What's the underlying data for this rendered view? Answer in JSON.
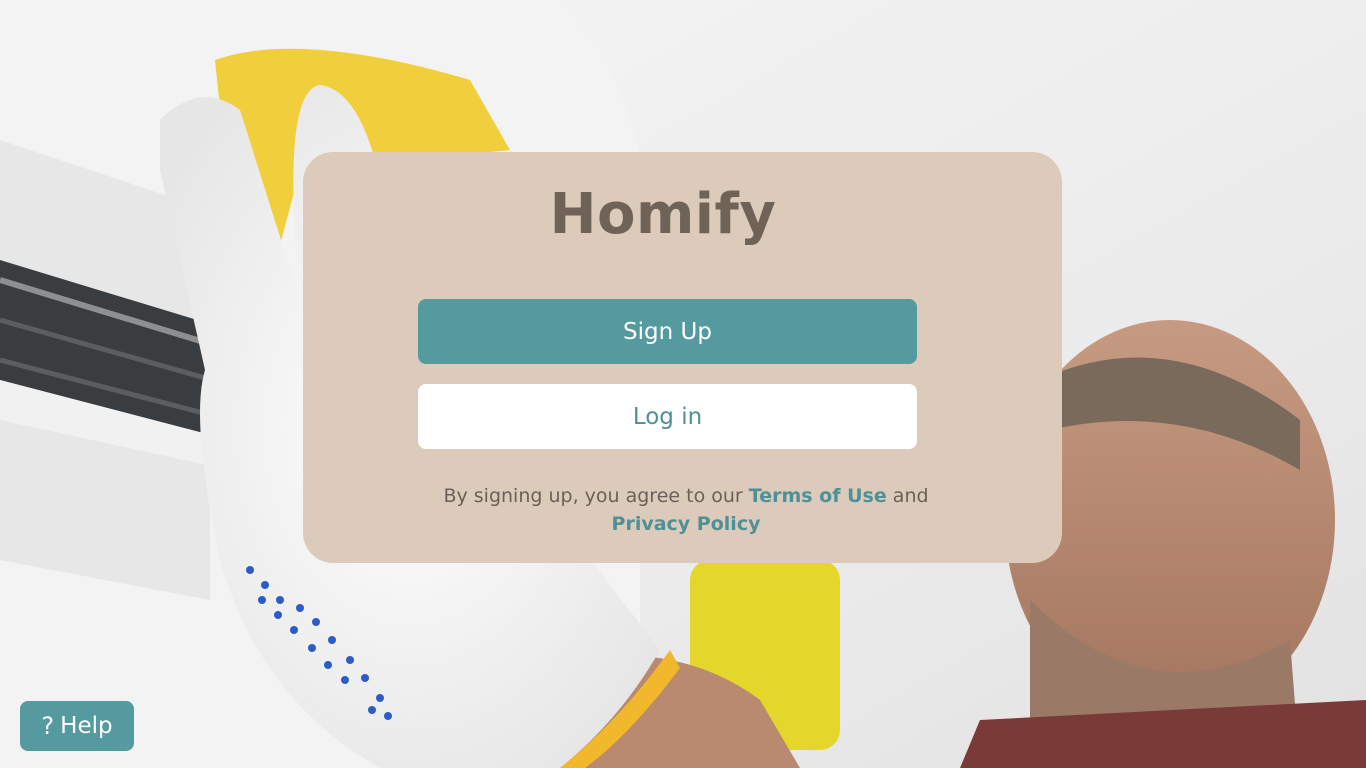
{
  "brand": {
    "name": "Homify"
  },
  "auth": {
    "signup_label": "Sign Up",
    "login_label": "Log in"
  },
  "terms": {
    "prefix": "By signing up, you agree to our",
    "terms_link": "Terms of Use",
    "middle": "and",
    "privacy_link": "Privacy Policy"
  },
  "help": {
    "label": "Help",
    "icon": "question-mark-icon"
  },
  "colors": {
    "accent": "#559a9e",
    "card": "#dccbbb",
    "brand_text": "#6f6256"
  }
}
